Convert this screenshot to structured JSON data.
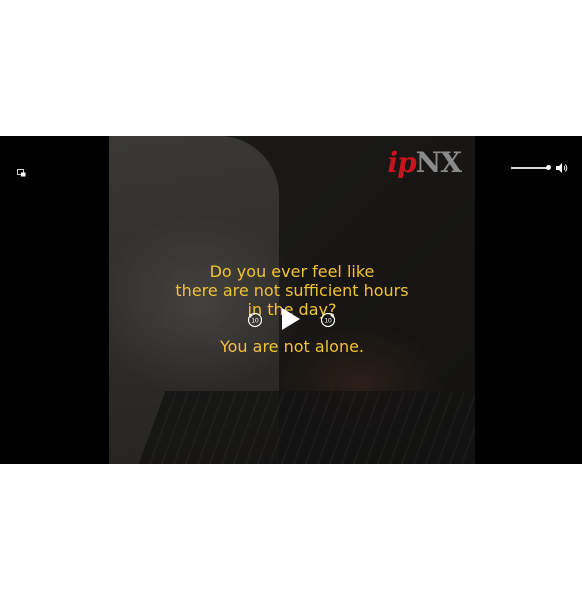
{
  "logo": {
    "ip": "ip",
    "nx": "NX"
  },
  "captions": {
    "line1": [
      "Do you ever feel like",
      "there are not sufficient hours",
      "in the day?"
    ],
    "line2": "You are not alone."
  },
  "controls": {
    "skip_back_seconds": "10",
    "skip_forward_seconds": "10",
    "volume_level": 1.0
  },
  "colors": {
    "caption": "#f2c230",
    "logo_ip": "#c8141e",
    "logo_nx": "#8a8a8a"
  },
  "icons": [
    "pip-icon",
    "rewind-10-icon",
    "play-icon",
    "forward-10-icon",
    "volume-icon"
  ]
}
